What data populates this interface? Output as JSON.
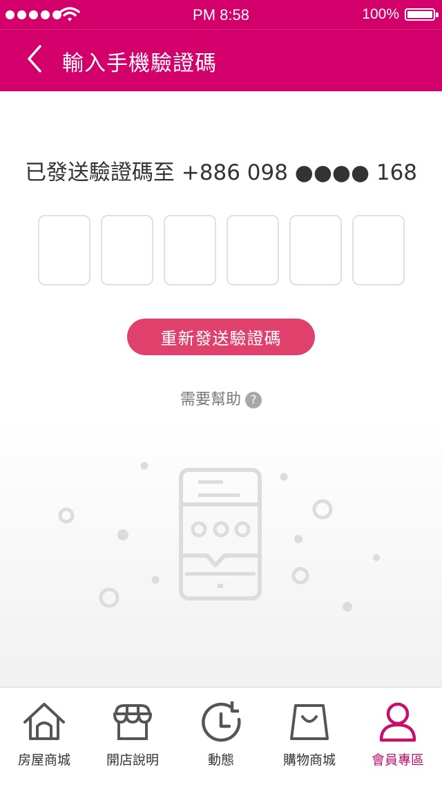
{
  "status_bar": {
    "time": "PM 8:58",
    "battery": "100%"
  },
  "nav": {
    "title": "輸入手機驗證碼",
    "back_icon": "chevron-left-icon"
  },
  "main": {
    "sent_text": "已發送驗證碼至 +886 098 ●●●● 168",
    "code_digits": [
      "",
      "",
      "",
      "",
      "",
      ""
    ],
    "resend_label": "重新發送驗證碼",
    "help_label": "需要幫助",
    "help_icon_glyph": "?"
  },
  "tabs": [
    {
      "label": "房屋商城",
      "icon": "house-icon",
      "active": false
    },
    {
      "label": "開店說明",
      "icon": "storefront-icon",
      "active": false
    },
    {
      "label": "動態",
      "icon": "refresh-clock-icon",
      "active": false
    },
    {
      "label": "購物商城",
      "icon": "shopping-bag-icon",
      "active": false
    },
    {
      "label": "會員專區",
      "icon": "user-icon",
      "active": true
    }
  ],
  "colors": {
    "brand": "#d3006b",
    "button": "#e0406c",
    "active_tab": "#c8106b"
  }
}
